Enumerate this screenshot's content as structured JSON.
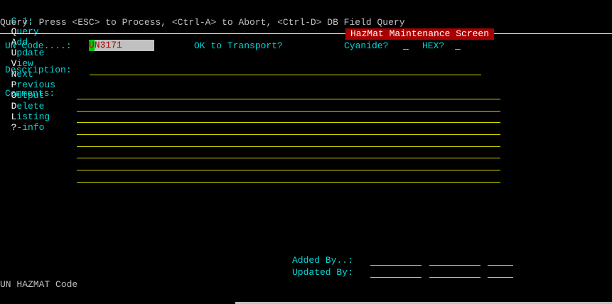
{
  "menu": {
    "prefix": "C 1:",
    "items": [
      {
        "hot": "Q",
        "rest": "uery"
      },
      {
        "hot": "A",
        "rest": "dd"
      },
      {
        "hot": "U",
        "rest": "pdate"
      },
      {
        "hot": "V",
        "rest": "iew"
      },
      {
        "hot": "N",
        "rest": "ext"
      },
      {
        "hot": "P",
        "rest": "revious"
      },
      {
        "hot": "O",
        "rest": "utput"
      },
      {
        "hot": "D",
        "rest": "elete"
      },
      {
        "hot": "L",
        "rest": "isting"
      },
      {
        "hot": "?",
        "rest": "-info"
      }
    ]
  },
  "hint": "Query: Press <ESC> to Process, <Ctrl-A> to Abort, <Ctrl-D> DB Field Query",
  "screen_title": "HazMat Maintenance Screen",
  "form": {
    "un_code_label": "UN Code....:",
    "un_code_cursor_char": "U",
    "un_code_value_rest": "N3171",
    "ok_transport_label": "OK to Transport?",
    "cyanide_label": "Cyanide?",
    "cyanide_value": "_",
    "hex_label": "HEX?",
    "hex_value": "_",
    "description_label": "Description:",
    "comments_label": "Comments:",
    "added_by_label": "Added By..:",
    "updated_by_label": "Updated By:"
  },
  "status_text": "UN HAZMAT Code",
  "colors": {
    "background": "#000000",
    "menu_text": "#00d8d8",
    "menu_hotkey": "#ffffff",
    "banner_bg": "#a80000",
    "field_line": "#d8d800",
    "field_bg": "#c0c0c0",
    "cursor": "#00c800"
  }
}
